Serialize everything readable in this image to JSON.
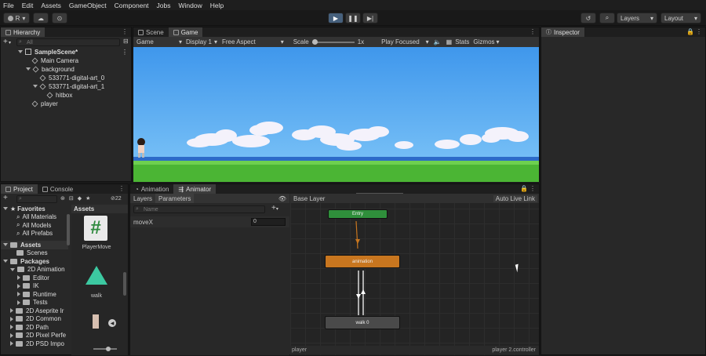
{
  "menu": [
    "File",
    "Edit",
    "Assets",
    "GameObject",
    "Component",
    "Jobs",
    "Window",
    "Help"
  ],
  "toolbar": {
    "account": "R",
    "layers": "Layers",
    "layout": "Layout"
  },
  "hierarchy": {
    "tab": "Hierarchy",
    "search_placeholder": "All",
    "items": [
      "SampleScene*",
      "Main Camera",
      "background",
      "533771-digital-art_0",
      "533771-digital-art_1",
      "hitbox",
      "player"
    ]
  },
  "scene_tabs": {
    "scene": "Scene",
    "game": "Game"
  },
  "game_bar": {
    "mode": "Game",
    "display": "Display 1",
    "aspect": "Free Aspect",
    "scale_label": "Scale",
    "scale_value": "1x",
    "play_focused": "Play Focused",
    "stats": "Stats",
    "gizmos": "Gizmos"
  },
  "inspector": {
    "tab": "Inspector"
  },
  "project": {
    "tabs": [
      "Project",
      "Console"
    ],
    "hidden_count": "22",
    "assets_header": "Assets",
    "tree": [
      "Favorites",
      "All Materials",
      "All Models",
      "All Prefabs",
      "Assets",
      "Scenes",
      "Packages",
      "2D Animation",
      "Editor",
      "IK",
      "Runtime",
      "Tests",
      "2D Aseprite Ir",
      "2D Common",
      "2D Path",
      "2D Pixel Perfe",
      "2D PSD Impo"
    ],
    "assets": [
      "PlayerMove",
      "walk"
    ]
  },
  "animator": {
    "tabs": [
      "Animation",
      "Animator"
    ],
    "subtabs": [
      "Layers",
      "Parameters"
    ],
    "name_placeholder": "Name",
    "param_name": "moveX",
    "param_value": "0",
    "layer": "Base Layer",
    "auto_live": "Auto Live Link",
    "nodes": {
      "entry": "Entry",
      "animation": "animation",
      "walk": "walk 0"
    },
    "footer_left": "player",
    "footer_right": "player 2.controller"
  },
  "colors": {
    "accent": "#46607c",
    "sky": "#5aaaf0",
    "grass": "#4bb534",
    "entry": "#2f8f3b",
    "state_orange": "#c8761f",
    "state_grey": "#4a4a4a"
  }
}
